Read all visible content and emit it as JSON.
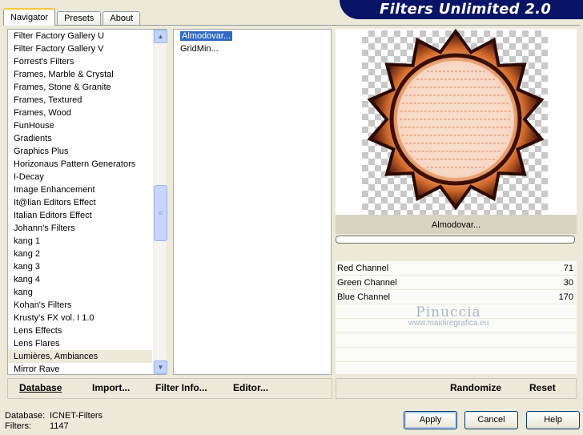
{
  "tabs": [
    "Navigator",
    "Presets",
    "About"
  ],
  "banner": {
    "title": "Filters Unlimited 2.0"
  },
  "categories": [
    "Filter Factory Gallery U",
    "Filter Factory Gallery V",
    "Forrest's Filters",
    "Frames, Marble & Crystal",
    "Frames, Stone & Granite",
    "Frames, Textured",
    "Frames, Wood",
    "FunHouse",
    "Gradients",
    "Graphics Plus",
    "Horizonaus Pattern Generators",
    "I-Decay",
    "Image Enhancement",
    "It@lian Editors Effect",
    "Italian Editors Effect",
    "Johann's Filters",
    "kang 1",
    "kang 2",
    "kang 3",
    "kang 4",
    "kang",
    "Kohan's Filters",
    "Krusty's FX vol. I 1.0",
    "Lens Effects",
    "Lens Flares",
    "Lumières, Ambiances",
    "Mirror Rave"
  ],
  "selected_category": "Lumières, Ambiances",
  "filters": [
    "Almodovar...",
    "GridMin..."
  ],
  "selected_filter": "Almodovar...",
  "preview": {
    "filter_name": "Almodovar..."
  },
  "channels": [
    {
      "label": "Red Channel",
      "value": "71"
    },
    {
      "label": "Green Channel",
      "value": "30"
    },
    {
      "label": "Blue Channel",
      "value": "170"
    }
  ],
  "watermark": {
    "line1": "Pinuccia",
    "line2": "www.maidiregrafica.eu"
  },
  "toolbar": {
    "database": "Database",
    "import": "Import...",
    "filter_info": "Filter Info...",
    "editor": "Editor...",
    "randomize": "Randomize",
    "reset": "Reset"
  },
  "status": {
    "database_label": "Database:",
    "database_value": "ICNET-Filters",
    "filters_label": "Filters:",
    "filters_value": "1147"
  },
  "buttons": {
    "apply": "Apply",
    "cancel": "Cancel",
    "help": "Help"
  },
  "icons": {
    "scroll_up": "chevron-up-icon",
    "scroll_down": "chevron-down-icon"
  }
}
